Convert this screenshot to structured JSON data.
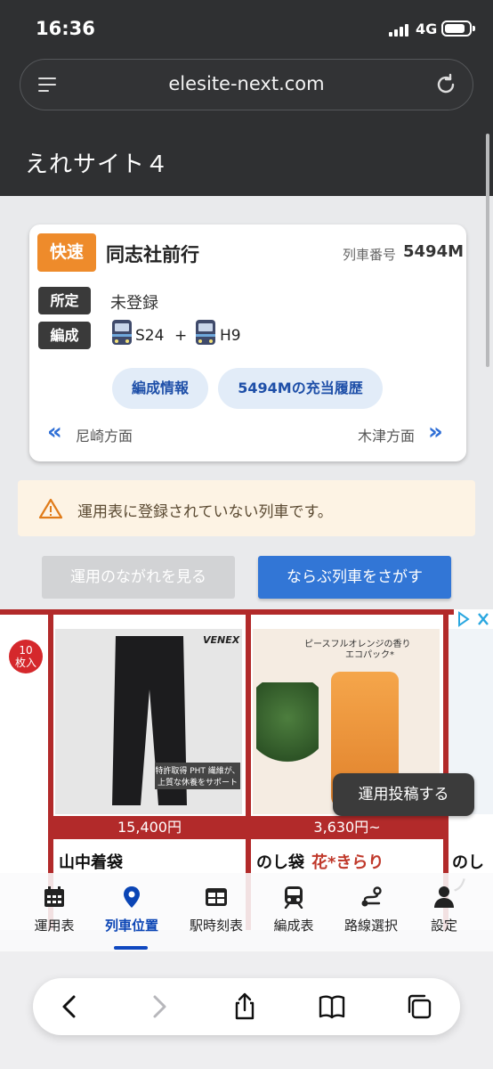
{
  "status_bar": {
    "time": "16:36",
    "network": "4G"
  },
  "browser": {
    "url": "elesite-next.com"
  },
  "app": {
    "title": "えれサイト４"
  },
  "train": {
    "type": "快速",
    "destination": "同志社前行",
    "number_label": "列車番号",
    "number": "5494M",
    "assignment_label": "所定",
    "assignment_value": "未登録",
    "formation_label": "編成",
    "formation_car1": "S24",
    "formation_plus": "+",
    "formation_car2": "H9",
    "btn_formation_info": "編成情報",
    "btn_history": "5494Mの充当履歴",
    "dir_left": "尼崎方面",
    "dir_right": "木津方面"
  },
  "warning": {
    "text": "運用表に登録されていない列車です。"
  },
  "actions": {
    "view_flow": "運用のながれを見る",
    "search_parallel": "ならぶ列車をさがす"
  },
  "ad": {
    "badge": "10\n枚入",
    "brand": "VENEX",
    "caption1": "特許取得 PHT 繊維が、上質な休養をサポート",
    "price1": "15,400円",
    "headline2": "ピースフルオレンジの香り",
    "sub2": "エコパック*",
    "price2": "3,630円~",
    "lower1": "山中着袋",
    "lower2": "のし袋",
    "lower2b": "花*きらり",
    "lower3": "のしノ"
  },
  "post_button": "運用投稿する",
  "nav": [
    {
      "label": "運用表",
      "icon": "calendar-icon"
    },
    {
      "label": "列車位置",
      "icon": "location-pin-icon"
    },
    {
      "label": "駅時刻表",
      "icon": "table-icon"
    },
    {
      "label": "編成表",
      "icon": "train-icon"
    },
    {
      "label": "路線選択",
      "icon": "route-icon"
    },
    {
      "label": "設定",
      "icon": "person-icon"
    }
  ]
}
